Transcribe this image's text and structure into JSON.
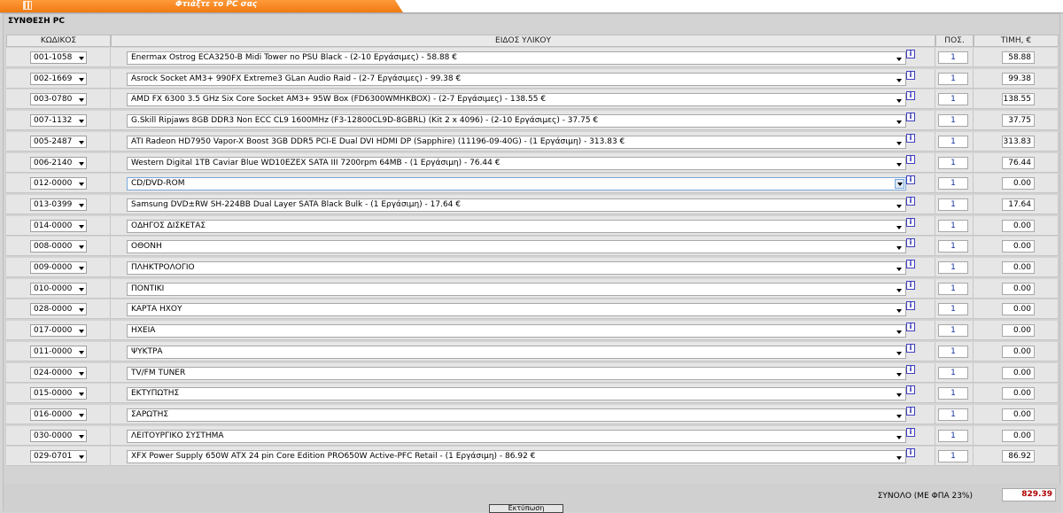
{
  "tab": {
    "label": "Φτιάξτε το PC σας"
  },
  "panel": {
    "title": "ΣΥΝΘΕΣΗ PC"
  },
  "columns": {
    "code": "ΚΩΔΙΚΟΣ",
    "item": "ΕΙΔΟΣ ΥΛΙΚΟΥ",
    "qty": "ΠΟΣ.",
    "price": "ΤΙΜΗ, €"
  },
  "info_label": "i",
  "rows": [
    {
      "code": "001-1058",
      "item": "Enermax Ostrog ECA3250-B Midi Tower no PSU Black - (2-10 Εργάσιμες) - 58.88 €",
      "qty": "1",
      "price": "58.88"
    },
    {
      "code": "002-1669",
      "item": "Asrock Socket AM3+ 990FX Extreme3 GLan Audio Raid - (2-7 Εργάσιμες) - 99.38 €",
      "qty": "1",
      "price": "99.38"
    },
    {
      "code": "003-0780",
      "item": "AMD FX 6300 3.5 GHz Six Core Socket AM3+ 95W Box (FD6300WMHKBOX) - (2-7 Εργάσιμες) - 138.55 €",
      "qty": "1",
      "price": "138.55"
    },
    {
      "code": "007-1132",
      "item": "G.Skill Ripjaws 8GB DDR3 Non ECC CL9 1600MHz (F3-12800CL9D-8GBRL) (Kit 2 x 4096) - (2-10 Εργάσιμες) - 37.75 €",
      "qty": "1",
      "price": "37.75"
    },
    {
      "code": "005-2487",
      "item": "ATI Radeon HD7950 Vapor-X Boost 3GB DDR5 PCI-E Dual DVI HDMI DP (Sapphire) (11196-09-40G) - (1 Εργάσιμη) - 313.83 €",
      "qty": "1",
      "price": "313.83"
    },
    {
      "code": "006-2140",
      "item": "Western Digital 1TB Caviar Blue WD10EZEX SATA III 7200rpm 64MB - (1 Εργάσιμη) - 76.44 €",
      "qty": "1",
      "price": "76.44"
    },
    {
      "code": "012-0000",
      "item": "CD/DVD-ROM",
      "qty": "1",
      "price": "0.00",
      "active": true
    },
    {
      "code": "013-0399",
      "item": "Samsung DVD±RW SH-224BB Dual Layer SATA Black Bulk - (1 Εργάσιμη) - 17.64 €",
      "qty": "1",
      "price": "17.64"
    },
    {
      "code": "014-0000",
      "item": "ΟΔΗΓΟΣ ΔΙΣΚΕΤΑΣ",
      "qty": "1",
      "price": "0.00"
    },
    {
      "code": "008-0000",
      "item": "ΟΘΟΝΗ",
      "qty": "1",
      "price": "0.00"
    },
    {
      "code": "009-0000",
      "item": "ΠΛΗΚΤΡΟΛΟΓΙΟ",
      "qty": "1",
      "price": "0.00"
    },
    {
      "code": "010-0000",
      "item": "ΠΟΝΤΙΚΙ",
      "qty": "1",
      "price": "0.00"
    },
    {
      "code": "028-0000",
      "item": "ΚΑΡΤΑ ΗΧΟΥ",
      "qty": "1",
      "price": "0.00"
    },
    {
      "code": "017-0000",
      "item": "ΗΧΕΙΑ",
      "qty": "1",
      "price": "0.00"
    },
    {
      "code": "011-0000",
      "item": "ΨΥΚΤΡΑ",
      "qty": "1",
      "price": "0.00"
    },
    {
      "code": "024-0000",
      "item": "TV/FM TUNER",
      "qty": "1",
      "price": "0.00"
    },
    {
      "code": "015-0000",
      "item": "ΕΚΤΥΠΩΤΗΣ",
      "qty": "1",
      "price": "0.00"
    },
    {
      "code": "016-0000",
      "item": "ΣΑΡΩΤΗΣ",
      "qty": "1",
      "price": "0.00"
    },
    {
      "code": "030-0000",
      "item": "ΛΕΙΤΟΥΡΓΙΚΟ ΣΥΣΤΗΜΑ",
      "qty": "1",
      "price": "0.00"
    },
    {
      "code": "029-0701",
      "item": "XFX Power Supply 650W ATX 24 pin Core Edition PRO650W Active-PFC Retail - (1 Εργάσιμη) - 86.92 €",
      "qty": "1",
      "price": "86.92"
    }
  ],
  "footer": {
    "total_label": "ΣΥΝΟΛΟ (ΜΕ ΦΠΑ 23%)",
    "total_value": "829.39"
  },
  "bottom_button": {
    "label": "Εκτύπωση"
  }
}
